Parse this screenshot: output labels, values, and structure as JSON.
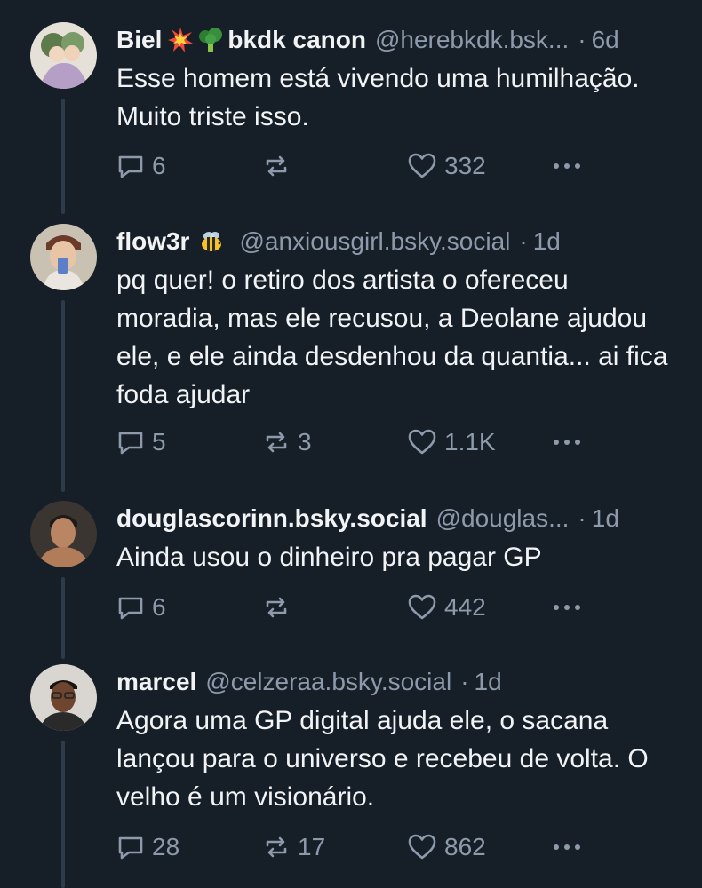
{
  "posts": [
    {
      "name": "Biel",
      "name_suffix": "bkdk canon",
      "handle": "@herebkdk.bsk...",
      "time": "6d",
      "text": "Esse homem está vivendo uma humilhação. Muito triste isso.",
      "replies": "6",
      "reposts": "",
      "likes": "332"
    },
    {
      "name": "flow3r",
      "name_suffix": "",
      "handle": "@anxiousgirl.bsky.social",
      "time": "1d",
      "text": "pq quer! o retiro dos artista o ofereceu moradia, mas ele recusou, a Deolane ajudou ele, e ele ainda desdenhou da quantia... ai fica foda ajudar",
      "replies": "5",
      "reposts": "3",
      "likes": "1.1K"
    },
    {
      "name": "douglascorinn.bsky.social",
      "name_suffix": "",
      "handle": "@douglas...",
      "time": "1d",
      "text": "Ainda usou o dinheiro pra pagar GP",
      "replies": "6",
      "reposts": "",
      "likes": "442"
    },
    {
      "name": "marcel",
      "name_suffix": "",
      "handle": "@celzeraa.bsky.social",
      "time": "1d",
      "text": "Agora uma GP digital ajuda ele, o sacana lançou para o universo e recebeu de volta. O velho é um visionário.",
      "replies": "28",
      "reposts": "17",
      "likes": "862"
    }
  ],
  "dot_separator": "·",
  "icons": {
    "reply": "reply-icon",
    "repost": "repost-icon",
    "like": "heart-icon",
    "more": "more-icon"
  },
  "colors": {
    "background": "#161e27",
    "text": "#f1f3f5",
    "muted": "#8d9aab",
    "thread_line": "#2e3b4a"
  }
}
